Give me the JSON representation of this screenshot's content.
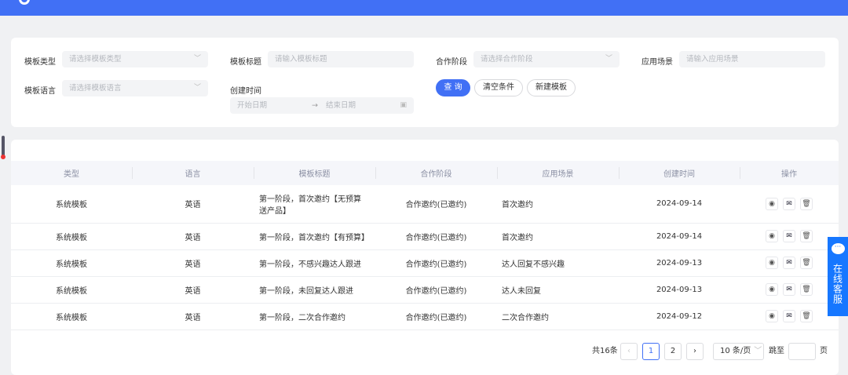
{
  "filters": {
    "type_label": "模板类型",
    "type_placeholder": "请选择模板类型",
    "title_label": "模板标题",
    "title_placeholder": "请输入模板标题",
    "stage_label": "合作阶段",
    "stage_placeholder": "请选择合作阶段",
    "scene_label": "应用场景",
    "scene_placeholder": "请输入应用场景",
    "lang_label": "模板语言",
    "lang_placeholder": "请选择模板语言",
    "created_label": "创建时间",
    "start_placeholder": "开始日期",
    "end_placeholder": "结束日期",
    "query": "查 询",
    "clear": "清空条件",
    "new": "新建模板"
  },
  "table": {
    "headers": [
      "类型",
      "语言",
      "模板标题",
      "合作阶段",
      "应用场景",
      "创建时间",
      "操作"
    ],
    "rows": [
      [
        "系统模板",
        "英语",
        "第一阶段，首次邀约【无预算送产品】",
        "合作邀约(已邀约)",
        "首次邀约",
        "2024-09-14"
      ],
      [
        "系统模板",
        "英语",
        "第一阶段，首次邀约【有预算】",
        "合作邀约(已邀约)",
        "首次邀约",
        "2024-09-14"
      ],
      [
        "系统模板",
        "英语",
        "第一阶段，不感兴趣达人跟进",
        "合作邀约(已邀约)",
        "达人回复不感兴趣",
        "2024-09-13"
      ],
      [
        "系统模板",
        "英语",
        "第一阶段，未回复达人跟进",
        "合作邀约(已邀约)",
        "达人未回复",
        "2024-09-13"
      ],
      [
        "系统模板",
        "英语",
        "第一阶段，二次合作邀约",
        "合作邀约(已邀约)",
        "二次合作邀约",
        "2024-09-12"
      ]
    ]
  },
  "pagination": {
    "total": "共16条",
    "page1": "1",
    "page2": "2",
    "page_size": "10 条/页",
    "jump": "跳至",
    "page_unit": "页"
  },
  "service": {
    "label": "在线客服"
  }
}
